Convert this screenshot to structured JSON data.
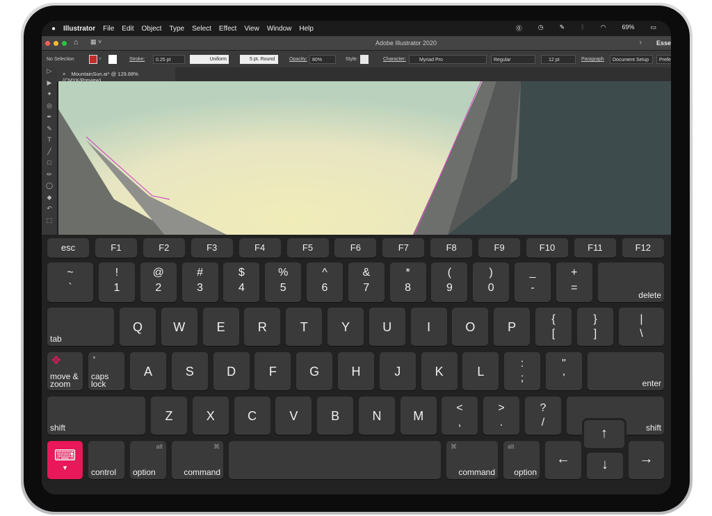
{
  "menubar": {
    "apple": "",
    "app": "Illustrator",
    "items": [
      "File",
      "Edit",
      "Object",
      "Type",
      "Select",
      "Effect",
      "View",
      "Window",
      "Help"
    ],
    "battery": "69%"
  },
  "titlebar": {
    "title": "Adobe Illustrator 2020",
    "workspace": "Essen"
  },
  "control": {
    "selection": "No Selection",
    "fill_color": "#c62b2b",
    "stroke_label": "Stroke:",
    "stroke_value": "0.25 pt",
    "stroke_profile": "Uniform",
    "brush": "5 pt. Round",
    "opacity_label": "Opacity:",
    "opacity_value": "80%",
    "style_label": "Style:",
    "character_label": "Character:",
    "font": "Myriad Pro",
    "font_style": "Regular",
    "font_size": "12 pt",
    "paragraph": "Paragraph",
    "document_setup": "Document Setup",
    "preferences": "Prefe"
  },
  "document_tab": {
    "close": "×",
    "title": "MountainSun.ai* @ 129.88% (CMYK/Preview)"
  },
  "toolbox": [
    "▷",
    "▶",
    "✦",
    "◎",
    "✒",
    "✎",
    "T",
    "╱",
    "□",
    "✏",
    "◯",
    "◆",
    "↶",
    "⬚"
  ],
  "keyboard": {
    "function_row": [
      "esc",
      "F1",
      "F2",
      "F3",
      "F4",
      "F5",
      "F6",
      "F7",
      "F8",
      "F9",
      "F10",
      "F11",
      "F12"
    ],
    "number_row": [
      [
        "~",
        "`"
      ],
      [
        "!",
        "1"
      ],
      [
        "@",
        "2"
      ],
      [
        "#",
        "3"
      ],
      [
        "$",
        "4"
      ],
      [
        "%",
        "5"
      ],
      [
        "^",
        "6"
      ],
      [
        "&",
        "7"
      ],
      [
        "*",
        "8"
      ],
      [
        "(",
        "9"
      ],
      [
        ")",
        "0"
      ],
      [
        "_",
        "-"
      ],
      [
        "+",
        "="
      ]
    ],
    "delete": "delete",
    "tab": "tab",
    "q_row": [
      "Q",
      "W",
      "E",
      "R",
      "T",
      "Y",
      "U",
      "I",
      "O",
      "P"
    ],
    "q_row_symbols": [
      [
        "{",
        "["
      ],
      [
        "}",
        "]"
      ],
      [
        "|",
        "\\"
      ]
    ],
    "move_zoom": "move & zoom",
    "caps_lock": "caps lock",
    "a_row": [
      "A",
      "S",
      "D",
      "F",
      "G",
      "H",
      "J",
      "K",
      "L"
    ],
    "a_row_symbols": [
      [
        ":",
        ";"
      ],
      [
        "\"",
        "'"
      ]
    ],
    "enter": "enter",
    "shift": "shift",
    "z_row": [
      "Z",
      "X",
      "C",
      "V",
      "B",
      "N",
      "M"
    ],
    "z_row_symbols": [
      [
        "<",
        ","
      ],
      [
        ">",
        "."
      ],
      [
        "?",
        "/"
      ]
    ],
    "control": "control",
    "option": "option",
    "alt": "alt",
    "command": "command",
    "command_symbol": "⌘",
    "arrows": {
      "up": "↑",
      "down": "↓",
      "left": "←",
      "right": "→"
    },
    "accent_color": "#e8185a"
  }
}
